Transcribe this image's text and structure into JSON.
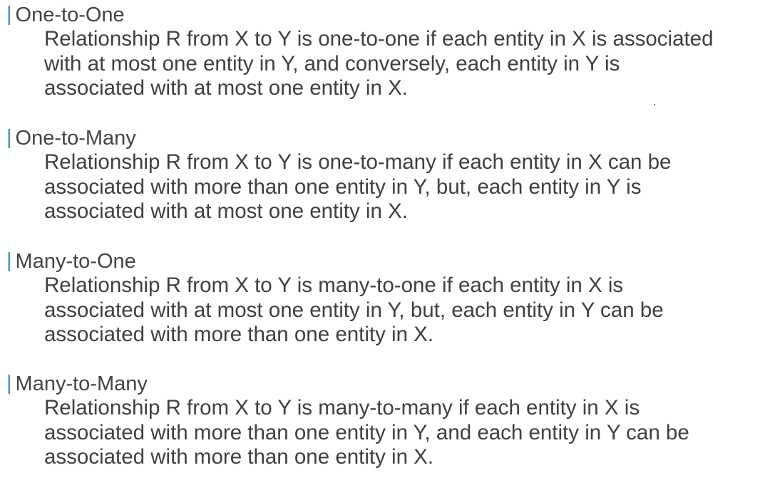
{
  "sections": [
    {
      "marker": "|",
      "title": "One-to-One",
      "lines": [
        "Relationship R from X to Y is one-to-one if each entity in X is associated",
        "with at most one entity in Y, and conversely, each entity in Y is",
        "associated with at most one entity in X."
      ]
    },
    {
      "marker": "|",
      "title": "One-to-Many",
      "lines": [
        "Relationship R from X to Y is one-to-many if each entity in X can be",
        "associated with more than one entity in Y,  but, each entity in Y is",
        "associated with at most one entity in X."
      ]
    },
    {
      "marker": "|",
      "title": "Many-to-One",
      "lines": [
        "Relationship R from X to Y is  many-to-one if each entity in X is",
        "associated with at most one entity in Y,  but, each entity in Y can be",
        "associated with more than one entity in X."
      ]
    },
    {
      "marker": "|",
      "title": "Many-to-Many",
      "lines": [
        "Relationship R from X to Y is  many-to-many if each entity in X is",
        "associated with more than one entity in Y, and each entity in Y can be",
        "associated with more than one entity in X."
      ]
    }
  ],
  "colors": {
    "accent": "#3a95c8",
    "text": "#404040",
    "background": "#ffffff"
  }
}
